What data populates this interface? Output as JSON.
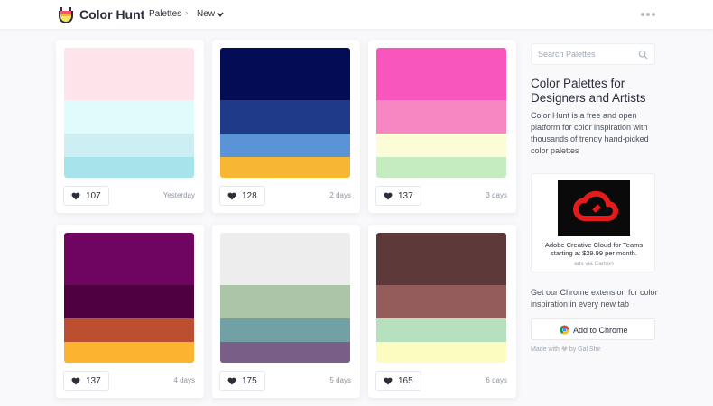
{
  "header": {
    "brand": "Color Hunt",
    "nav_palettes": "Palettes",
    "nav_separator": "›",
    "nav_new": "New"
  },
  "palettes": [
    {
      "colors": [
        "#ffe4ec",
        "#e0fbfb",
        "#cdeff3",
        "#a6e3ea"
      ],
      "likes": "107",
      "date": "Yesterday"
    },
    {
      "colors": [
        "#050c56",
        "#203a8a",
        "#5a94d6",
        "#f8b732"
      ],
      "likes": "128",
      "date": "2 days"
    },
    {
      "colors": [
        "#f856bc",
        "#f787c2",
        "#fcfcd6",
        "#c5ecc0"
      ],
      "likes": "137",
      "date": "3 days"
    },
    {
      "colors": [
        "#6f0461",
        "#4f0040",
        "#bc4f2f",
        "#fcb32f"
      ],
      "likes": "137",
      "date": "4 days"
    },
    {
      "colors": [
        "#ededed",
        "#acc5a9",
        "#71a1a4",
        "#795f88"
      ],
      "likes": "175",
      "date": "5 days"
    },
    {
      "colors": [
        "#5d3939",
        "#945c5a",
        "#b7e0be",
        "#fcfcc1"
      ],
      "likes": "165",
      "date": "6 days"
    }
  ],
  "sidebar": {
    "search_placeholder": "Search Palettes",
    "title": "Color Palettes for Designers and Artists",
    "description": "Color Hunt is a free and open platform for color inspiration with thousands of trendy hand-picked color palettes",
    "ad_text": "Adobe Creative Cloud for Teams starting at $29.99 per month.",
    "ad_via": "ads via Carbon",
    "extension_text": "Get our Chrome extension for color inspiration in every new tab",
    "chrome_button": "Add to Chrome",
    "made_with_prefix": "Made with",
    "made_with_suffix": "by Gal Shir"
  },
  "colors": {
    "heart": "#2b2f3a",
    "adobe_red": "#e41b1b"
  }
}
